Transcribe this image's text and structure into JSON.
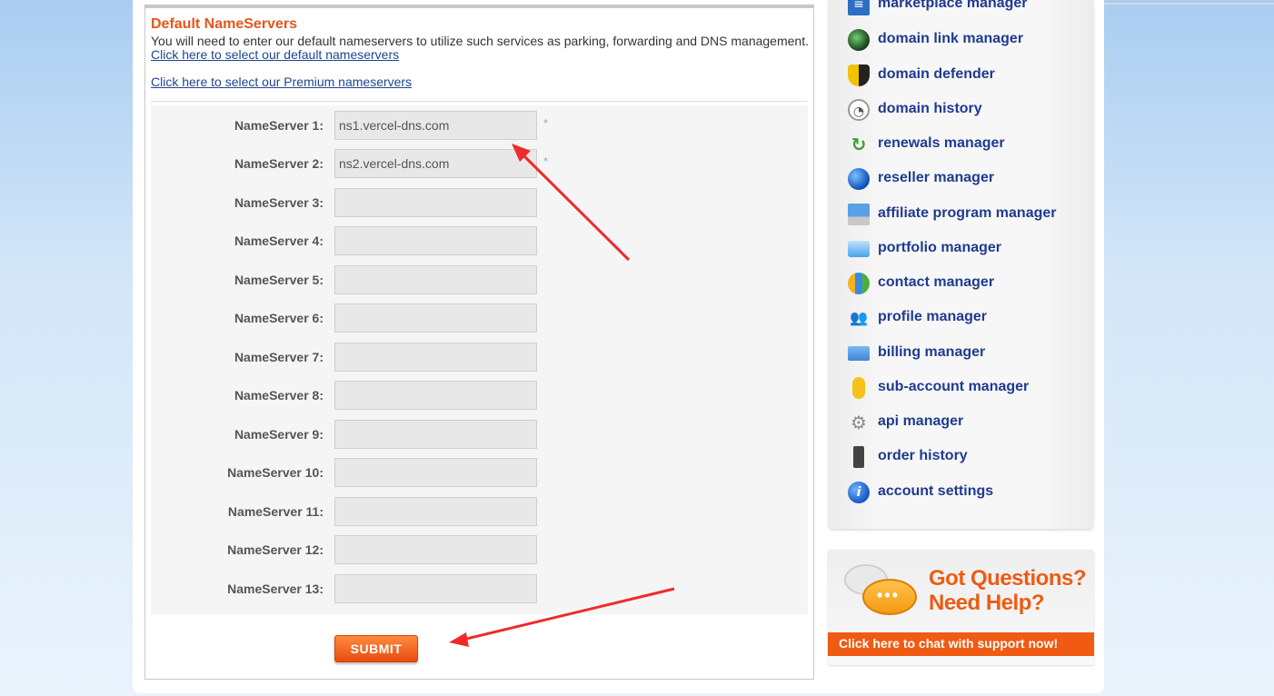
{
  "section": {
    "title": "Default NameServers",
    "description": "You will need to enter our default nameservers to utilize such services as parking, forwarding and DNS management.",
    "link_default": "Click here to select our default nameservers",
    "link_premium": "Click here to select our Premium nameservers"
  },
  "nameservers": [
    {
      "label": "NameServer 1:",
      "value": "ns1.vercel-dns.com",
      "required": "*"
    },
    {
      "label": "NameServer 2:",
      "value": "ns2.vercel-dns.com",
      "required": "*"
    },
    {
      "label": "NameServer 3:",
      "value": "",
      "required": ""
    },
    {
      "label": "NameServer 4:",
      "value": "",
      "required": ""
    },
    {
      "label": "NameServer 5:",
      "value": "",
      "required": ""
    },
    {
      "label": "NameServer 6:",
      "value": "",
      "required": ""
    },
    {
      "label": "NameServer 7:",
      "value": "",
      "required": ""
    },
    {
      "label": "NameServer 8:",
      "value": "",
      "required": ""
    },
    {
      "label": "NameServer 9:",
      "value": "",
      "required": ""
    },
    {
      "label": "NameServer 10:",
      "value": "",
      "required": ""
    },
    {
      "label": "NameServer 11:",
      "value": "",
      "required": ""
    },
    {
      "label": "NameServer 12:",
      "value": "",
      "required": ""
    },
    {
      "label": "NameServer 13:",
      "value": "",
      "required": ""
    }
  ],
  "submit_label": "SUBMIT",
  "sidebar": {
    "items": [
      {
        "label": "marketplace manager",
        "icon": "marketplace-icon"
      },
      {
        "label": "domain link manager",
        "icon": "domain-link-icon"
      },
      {
        "label": "domain defender",
        "icon": "shield-icon"
      },
      {
        "label": "domain history",
        "icon": "clock-icon"
      },
      {
        "label": "renewals manager",
        "icon": "renew-arrow-icon"
      },
      {
        "label": "reseller manager",
        "icon": "globe-icon"
      },
      {
        "label": "affiliate program manager",
        "icon": "computer-icon"
      },
      {
        "label": "portfolio manager",
        "icon": "folder-icon"
      },
      {
        "label": "contact manager",
        "icon": "contacts-icon"
      },
      {
        "label": "profile manager",
        "icon": "people-icon"
      },
      {
        "label": "billing manager",
        "icon": "credit-card-icon"
      },
      {
        "label": "sub-account manager",
        "icon": "user-icon"
      },
      {
        "label": "api manager",
        "icon": "gear-icon"
      },
      {
        "label": "order history",
        "icon": "phone-icon"
      },
      {
        "label": "account settings",
        "icon": "info-icon"
      }
    ]
  },
  "help": {
    "line1": "Got Questions?",
    "line2": "Need Help?",
    "cta": "Click here to chat with support now!"
  },
  "colors": {
    "accent_orange": "#e5561a",
    "link_blue": "#1d4690",
    "sidebar_text": "#1f3b8f",
    "annotation_red": "#ee2b2b"
  }
}
